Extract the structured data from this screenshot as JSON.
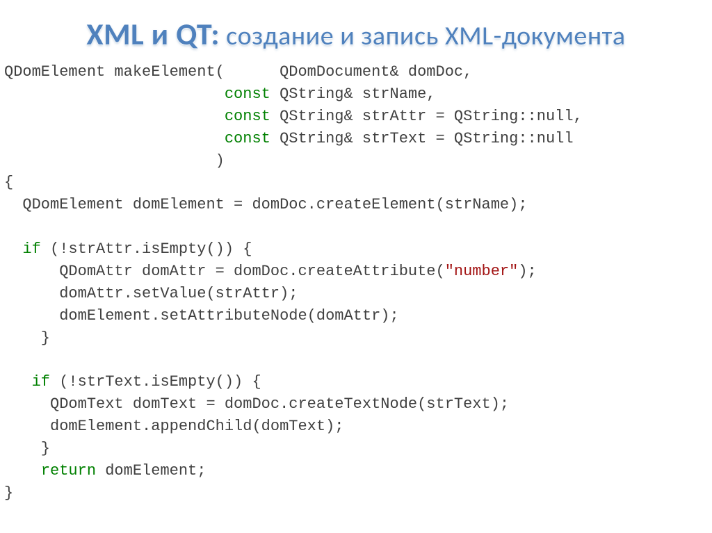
{
  "title": {
    "big": "XML и QT:",
    "rest": " создание и запись XML-документа"
  },
  "code": {
    "l01a": "QDomElement makeElement(      QDomDocument& domDoc,",
    "l02a": "                        ",
    "l02b": "const",
    "l02c": " QString& strName,",
    "l03a": "                        ",
    "l03b": "const",
    "l03c": " QString& strAttr = QString::null,",
    "l04a": "                        ",
    "l04b": "const",
    "l04c": " QString& strText = QString::null",
    "l05": "                       )",
    "l06": "{",
    "l07": "  QDomElement domElement = domDoc.createElement(strName);",
    "l08": "",
    "l09a": "  ",
    "l09b": "if",
    "l09c": " (!strAttr.isEmpty()) {",
    "l10a": "      QDomAttr domAttr = domDoc.createAttribute(",
    "l10b": "\"number\"",
    "l10c": ");",
    "l11": "      domAttr.setValue(strAttr);",
    "l12": "      domElement.setAttributeNode(domAttr);",
    "l13": "    }",
    "l14": "",
    "l15a": "   ",
    "l15b": "if",
    "l15c": " (!strText.isEmpty()) {",
    "l16": "     QDomText domText = domDoc.createTextNode(strText);",
    "l17": "     domElement.appendChild(domText);",
    "l18": "    }",
    "l19a": "    ",
    "l19b": "return",
    "l19c": " domElement;",
    "l20": "}"
  }
}
